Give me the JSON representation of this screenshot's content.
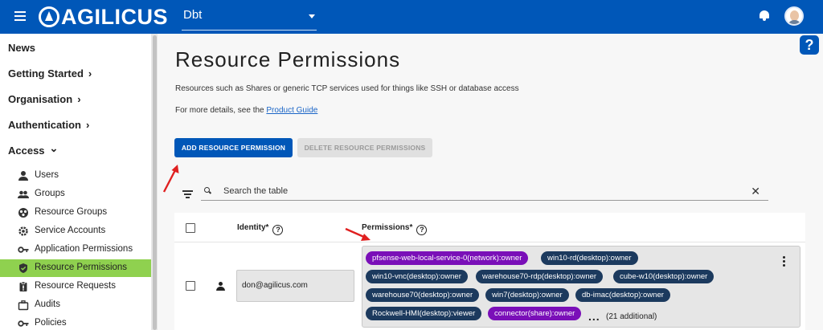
{
  "header": {
    "logo_text": "AGILICUS",
    "org_selected": "Dbt"
  },
  "help_label": "?",
  "sidebar": {
    "top_items": [
      {
        "label": "News",
        "chevron": ""
      },
      {
        "label": "Getting Started",
        "chevron": "›"
      },
      {
        "label": "Organisation",
        "chevron": "›"
      },
      {
        "label": "Authentication",
        "chevron": "›"
      },
      {
        "label": "Access",
        "chevron": "⌄"
      }
    ],
    "sub_items": [
      {
        "label": "Users",
        "icon": "person-icon"
      },
      {
        "label": "Groups",
        "icon": "group-icon"
      },
      {
        "label": "Resource Groups",
        "icon": "resource-groups-icon"
      },
      {
        "label": "Service Accounts",
        "icon": "service-accounts-icon"
      },
      {
        "label": "Application Permissions",
        "icon": "key-icon"
      },
      {
        "label": "Resource Permissions",
        "icon": "shield-check-icon",
        "active": true
      },
      {
        "label": "Resource Requests",
        "icon": "clipboard-icon"
      },
      {
        "label": "Audits",
        "icon": "briefcase-icon"
      },
      {
        "label": "Policies",
        "icon": "key-icon"
      }
    ]
  },
  "main": {
    "title": "Resource Permissions",
    "description": "Resources such as Shares or generic TCP services used for things like SSH or database access",
    "more_prefix": "For more details, see the ",
    "more_link": "Product Guide",
    "add_button": "ADD RESOURCE PERMISSION",
    "delete_button": "DELETE RESOURCE PERMISSIONS",
    "search_placeholder": "Search the table",
    "clear_label": "✕"
  },
  "table": {
    "col_identity": "Identity*",
    "col_permissions": "Permissions*",
    "rows": [
      {
        "identity": "don@agilicus.com",
        "chips": [
          "pfsense-web-local-service-0(network):owner",
          "win10-rd(desktop):owner",
          "win10-vnc(desktop):owner",
          "warehouse70-rdp(desktop):owner",
          "cube-w10(desktop):owner",
          "warehouse70(desktop):owner",
          "win7(desktop):owner",
          "db-imac(desktop):owner",
          "Rockwell-HMI(desktop):viewer",
          "connector(share):owner"
        ],
        "more_dots": "...",
        "more_count": "(21 additional)"
      }
    ]
  },
  "colors": {
    "brand": "#0057b8",
    "active_nav": "#8fd14f",
    "chip_dark": "#1c3a5e",
    "chip_purple": "#7a0fb8",
    "annotation_arrow": "#e02020"
  }
}
